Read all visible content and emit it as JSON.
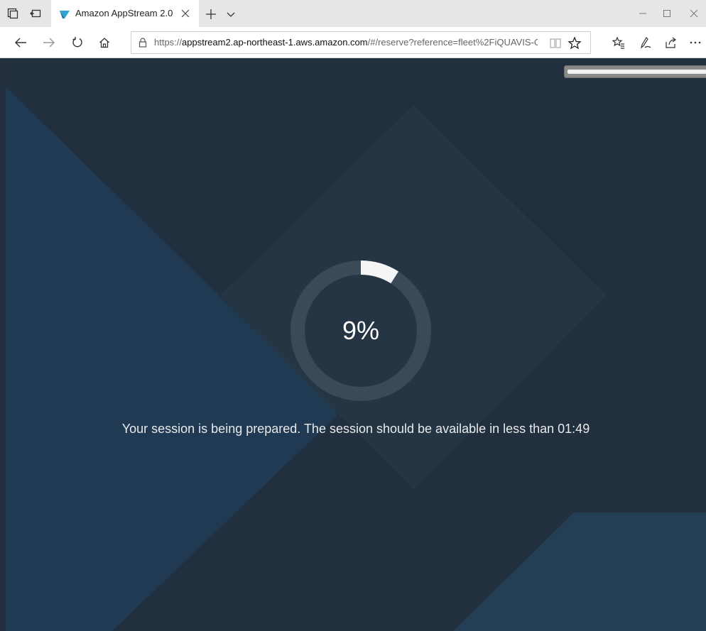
{
  "browser": {
    "tab": {
      "title": "Amazon AppStream 2.0"
    },
    "address": {
      "scheme": "https://",
      "host": "appstream2.ap-northeast-1.aws.amazon.com",
      "path": "/#/reserve?reference=fleet%2FiQUAVIS-O"
    }
  },
  "session": {
    "progress_label": "9%",
    "progress_value": 0.09,
    "message": "Your session is being prepared. The session should be available in less than 01:49"
  },
  "colors": {
    "page_bg": "#222f3e",
    "diamond": "#253544",
    "left_panel": "#1f3a52",
    "ring_track": "#3a4a59",
    "ring_fill": "#f5f5f5"
  }
}
